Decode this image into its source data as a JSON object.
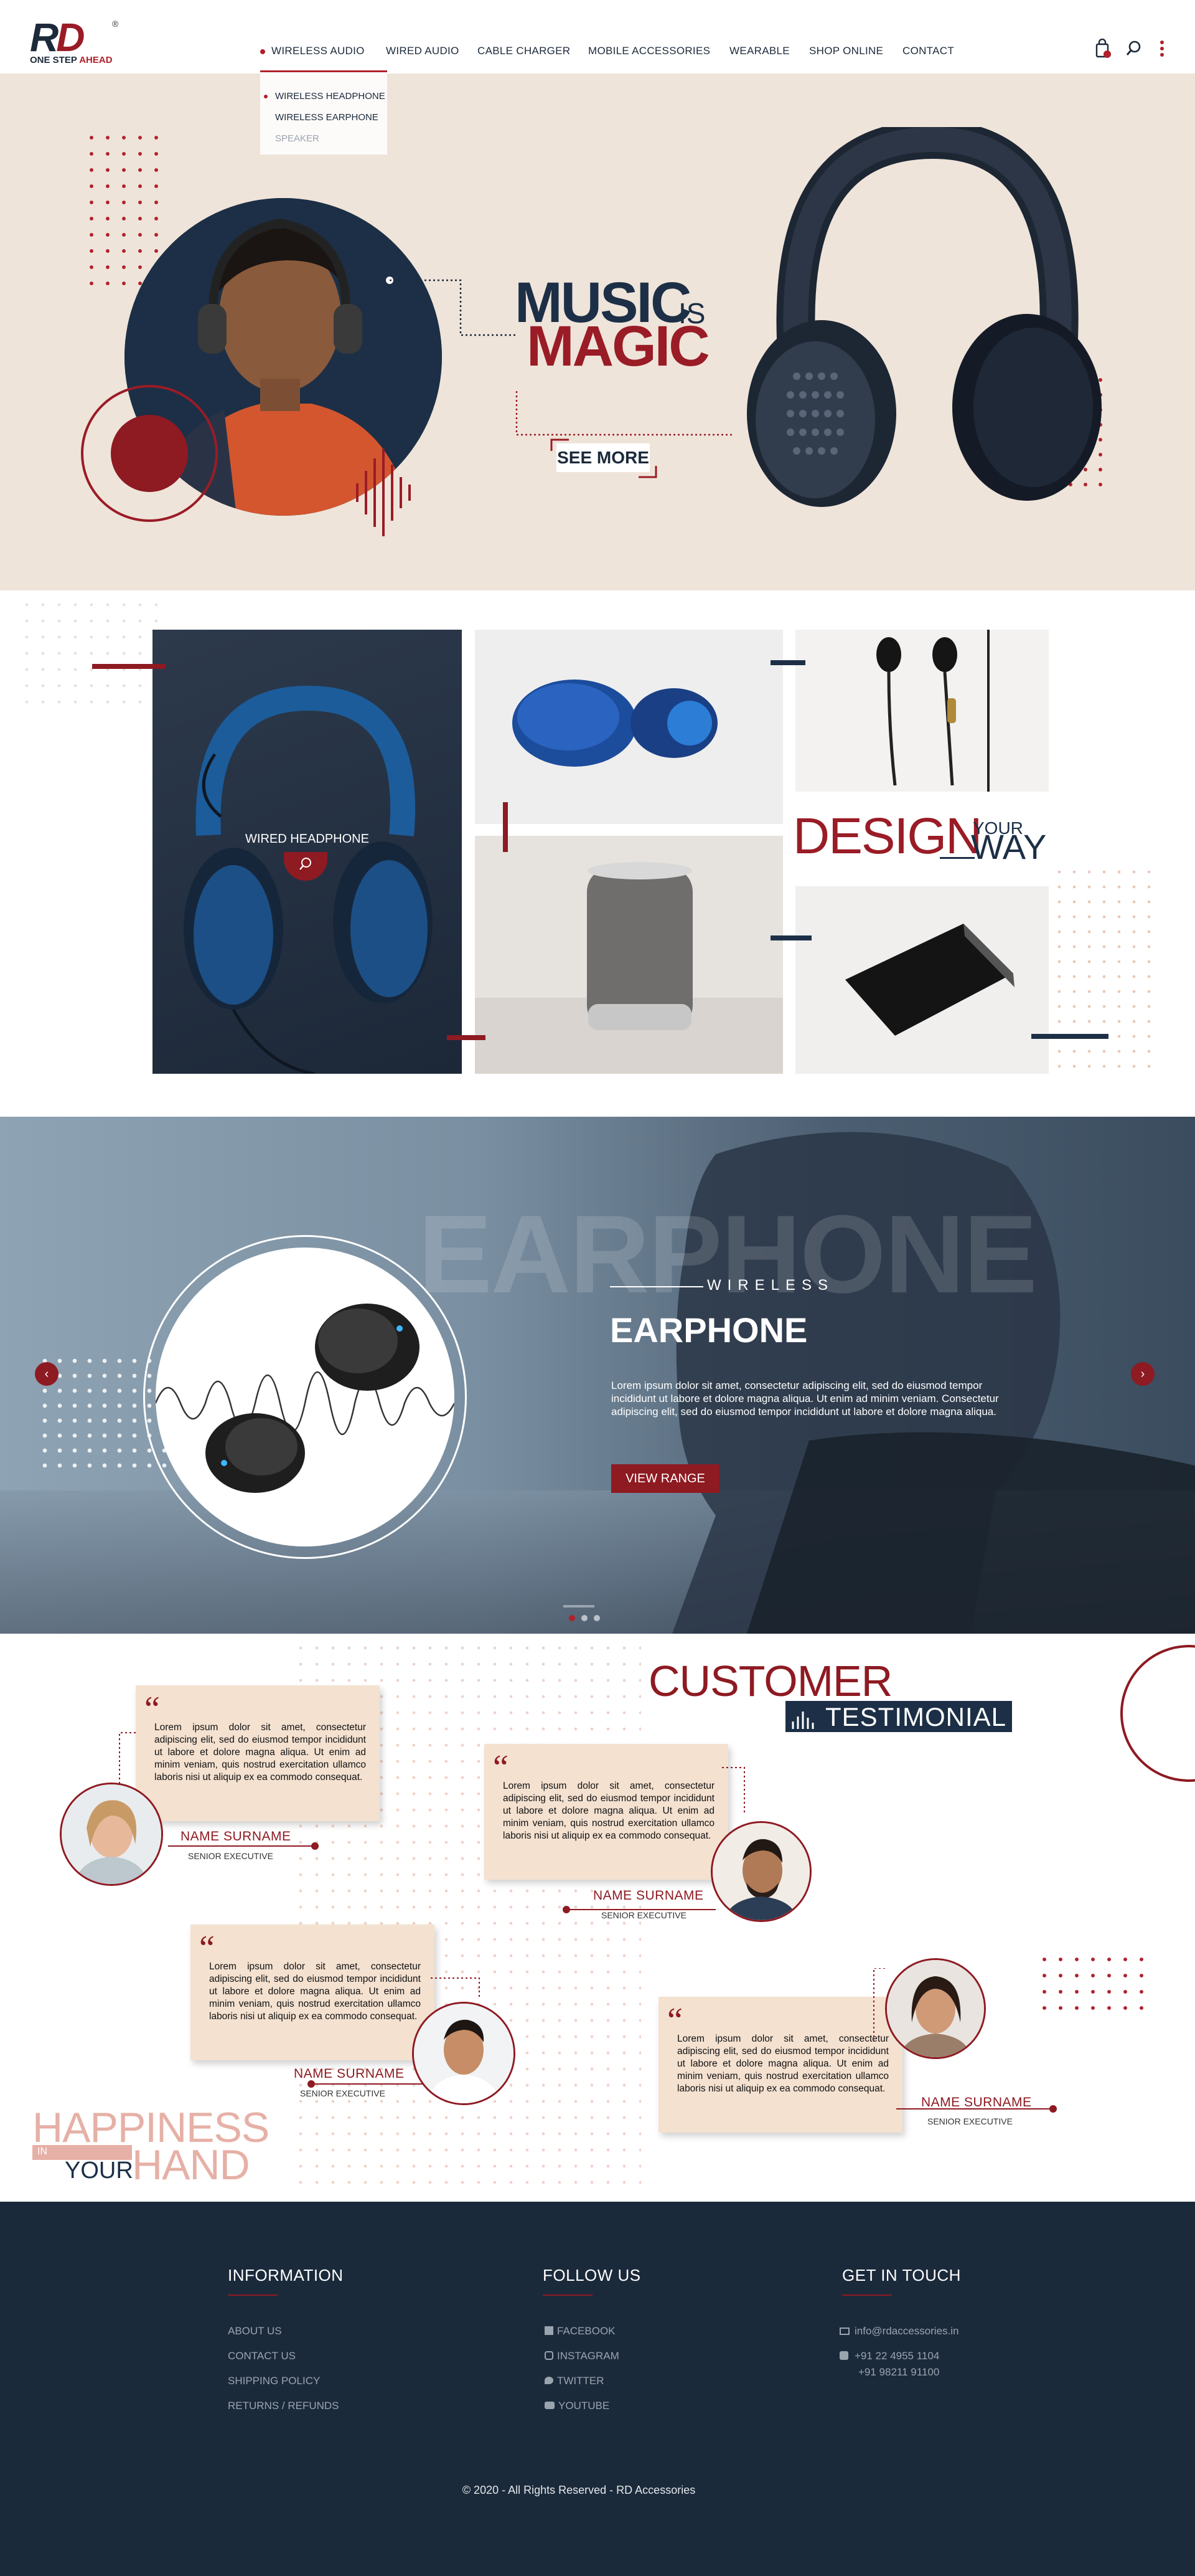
{
  "brand": {
    "logo_letters": "RD",
    "registered": "®",
    "tagline_prefix": "ONE STEP",
    "tagline_accent": "AHEAD"
  },
  "nav": {
    "items": [
      "WIRELESS AUDIO",
      "WIRED AUDIO",
      "CABLE CHARGER",
      "MOBILE ACCESSORIES",
      "WEARABLE",
      "SHOP ONLINE",
      "CONTACT"
    ],
    "active": "WIRELESS AUDIO",
    "dropdown": [
      "WIRELESS HEADPHONE",
      "WIRELESS EARPHONE",
      "SPEAKER"
    ],
    "icons": [
      "shopping-bag-icon",
      "search-icon",
      "more-vertical-icon"
    ]
  },
  "hero": {
    "title_1": "MUSIC",
    "title_is": "IS",
    "title_2": "MAGIC",
    "cta": "SEE MORE"
  },
  "products": {
    "headphone_label": "WIRED HEADPHONE",
    "tagline_design": "DESIGN",
    "tagline_your": "YOUR",
    "tagline_way": "WAY"
  },
  "slider": {
    "bg_word": "EARPHONE",
    "kicker": "WIRELESS",
    "title": "EARPHONE",
    "body": "Lorem ipsum dolor sit amet, consectetur adipiscing elit, sed do eiusmod tempor incididunt ut labore et dolore magna aliqua. Ut enim ad minim veniam. Consectetur adipiscing elit, sed do eiusmod tempor incididunt ut labore et dolore magna aliqua.",
    "cta": "VIEW RANGE",
    "prev": "‹",
    "next": "›",
    "pages": 3,
    "active_page": 1
  },
  "testimonials": {
    "title_1": "CUSTOMER",
    "title_2": "TESTIMONIAL",
    "items": [
      {
        "text": "Lorem ipsum dolor sit amet, consectetur adipiscing elit, sed do eiusmod tempor incididunt ut labore et dolore magna aliqua. Ut enim ad minim veniam, quis nostrud exercitation ullamco laboris nisi ut aliquip ex ea commodo consequat.",
        "name": "NAME SURNAME",
        "role": "SENIOR EXECUTIVE"
      },
      {
        "text": "Lorem ipsum dolor sit amet, consectetur adipiscing elit, sed do eiusmod tempor incididunt ut labore et dolore magna aliqua. Ut enim ad minim veniam, quis nostrud exercitation ullamco laboris nisi ut aliquip ex ea commodo consequat.",
        "name": "NAME SURNAME",
        "role": "SENIOR EXECUTIVE"
      },
      {
        "text": "Lorem ipsum dolor sit amet, consectetur adipiscing elit, sed do eiusmod tempor incididunt ut labore et dolore magna aliqua. Ut enim ad minim veniam, quis nostrud exercitation ullamco laboris nisi ut aliquip ex ea commodo consequat.",
        "name": "NAME SURNAME",
        "role": "SENIOR EXECUTIVE"
      },
      {
        "text": "Lorem ipsum dolor sit amet, consectetur adipiscing elit, sed do eiusmod tempor incididunt ut labore et dolore magna aliqua. Ut enim ad minim veniam, quis nostrud exercitation ullamco laboris nisi ut aliquip ex ea commodo consequat.",
        "name": "NAME SURNAME",
        "role": "SENIOR EXECUTIVE"
      }
    ],
    "happiness_1": "HAPPINESS",
    "happiness_in": "IN",
    "happiness_your": "YOUR",
    "happiness_hand": "HAND"
  },
  "footer": {
    "info_title": "INFORMATION",
    "info_links": [
      "ABOUT US",
      "CONTACT US",
      "SHIPPING POLICY",
      "RETURNS / REFUNDS"
    ],
    "follow_title": "FOLLOW US",
    "social": [
      "FACEBOOK",
      "INSTAGRAM",
      "TWITTER",
      "YOUTUBE"
    ],
    "touch_title": "GET IN TOUCH",
    "email": "info@rdaccessories.in",
    "phone_1": "+91 22 4955 1104",
    "phone_2": "+91 98211 91100",
    "copyright": "© 2020 - All Rights Reserved - RD Accessories"
  },
  "colors": {
    "brand_red": "#9a1c26",
    "navy": "#1c2f46",
    "hero_bg": "#efe4da",
    "card_bg": "#f4e1d0",
    "footer_bg": "#1b2a3b"
  }
}
